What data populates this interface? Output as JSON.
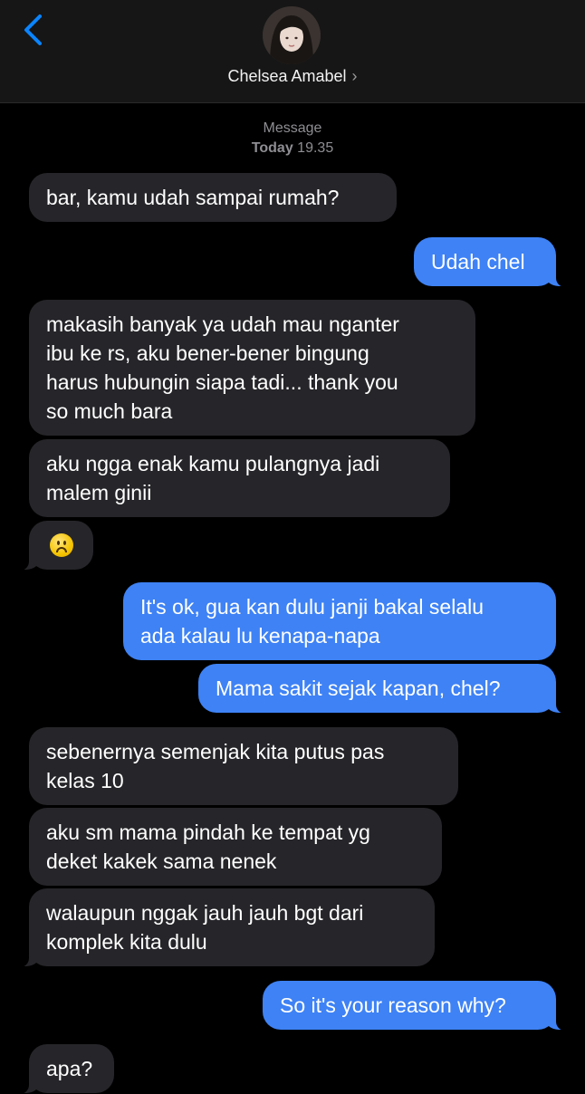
{
  "header": {
    "contact_name": "Chelsea Amabel",
    "chevron": "›",
    "back_icon": "chevron-left-icon"
  },
  "meta": {
    "service": "Message",
    "day": "Today",
    "time": "19.35"
  },
  "colors": {
    "incoming_bubble": "#26262a",
    "outgoing_bubble": "#3e82f5",
    "accent": "#0a84ff"
  },
  "messages": [
    {
      "from": "contact",
      "lines": [
        "bar, kamu udah sampai rumah?"
      ]
    },
    {
      "from": "me",
      "lines": [
        "Udah chel"
      ]
    },
    {
      "from": "contact",
      "lines": [
        "makasih banyak ya udah mau nganter",
        "ibu ke rs, aku bener-bener bingung",
        "harus hubungin siapa tadi... thank you",
        "so much bara"
      ]
    },
    {
      "from": "contact",
      "lines": [
        "aku ngga enak kamu pulangnya jadi",
        "malem ginii"
      ]
    },
    {
      "from": "contact",
      "emoji": "frowning-face"
    },
    {
      "from": "me",
      "lines": [
        "It's ok, gua kan dulu janji bakal selalu",
        "ada kalau lu kenapa-napa"
      ]
    },
    {
      "from": "me",
      "lines": [
        "Mama sakit sejak kapan, chel?"
      ]
    },
    {
      "from": "contact",
      "lines": [
        "sebenernya semenjak kita putus pas",
        "kelas 10"
      ]
    },
    {
      "from": "contact",
      "lines": [
        "aku sm mama pindah ke tempat yg",
        "deket kakek sama nenek"
      ]
    },
    {
      "from": "contact",
      "lines": [
        "walaupun nggak jauh jauh bgt dari",
        "komplek kita dulu"
      ]
    },
    {
      "from": "me",
      "lines": [
        "So it's your reason why?"
      ]
    },
    {
      "from": "contact",
      "lines": [
        "apa?"
      ]
    }
  ]
}
